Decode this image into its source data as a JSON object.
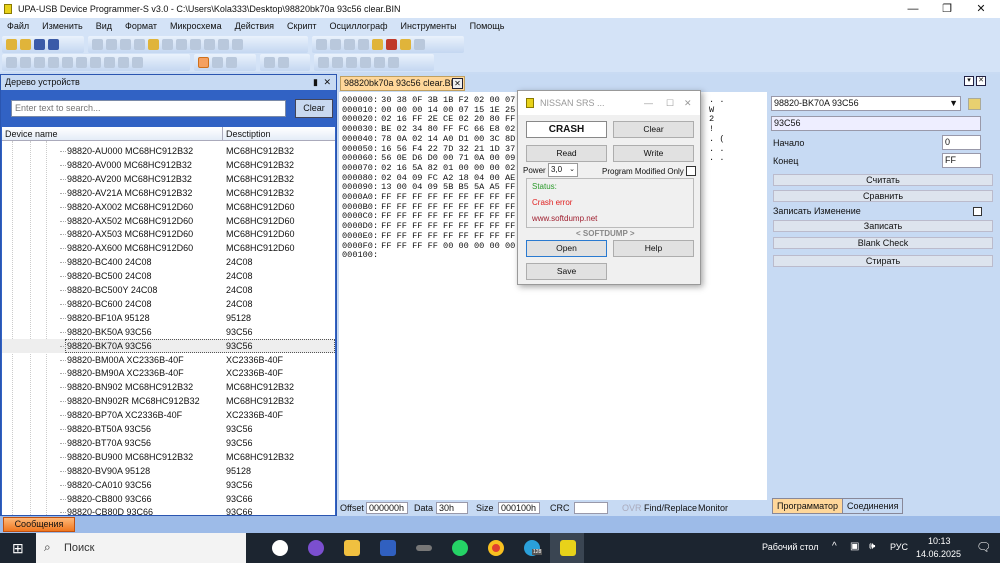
{
  "window": {
    "title": "UPA-USB Device Programmer-S v3.0 - C:\\Users\\Kola333\\Desktop\\98820bk70a 93c56 clear.BIN",
    "minimize": "—",
    "restore": "❐",
    "close": "✕"
  },
  "menu": [
    "Файл",
    "Изменить",
    "Вид",
    "Формат",
    "Микросхема",
    "Действия",
    "Скрипт",
    "Осциллограф",
    "Инструменты",
    "Помощь"
  ],
  "device_tree": {
    "title": "Дерево устройств",
    "search_placeholder": "Enter text to search...",
    "clear_label": "Clear",
    "col_name": "Device name",
    "col_desc": "Desctiption",
    "selected_index": 14,
    "rows": [
      [
        "98820-AU000 MC68HC912B32",
        "MC68HC912B32"
      ],
      [
        "98820-AV000 MC68HC912B32",
        "MC68HC912B32"
      ],
      [
        "98820-AV200 MC68HC912B32",
        "MC68HC912B32"
      ],
      [
        "98820-AV21A MC68HC912B32",
        "MC68HC912B32"
      ],
      [
        "98820-AX002 MC68HC912D60",
        "MC68HC912D60"
      ],
      [
        "98820-AX502 MC68HC912D60",
        "MC68HC912D60"
      ],
      [
        "98820-AX503 MC68HC912D60",
        "MC68HC912D60"
      ],
      [
        "98820-AX600 MC68HC912D60",
        "MC68HC912D60"
      ],
      [
        "98820-BC400 24C08",
        "24C08"
      ],
      [
        "98820-BC500 24C08",
        "24C08"
      ],
      [
        "98820-BC500Y 24C08",
        "24C08"
      ],
      [
        "98820-BC600 24C08",
        "24C08"
      ],
      [
        "98820-BF10A 95128",
        "95128"
      ],
      [
        "98820-BK50A 93C56",
        "93C56"
      ],
      [
        "98820-BK70A 93C56",
        "93C56"
      ],
      [
        "98820-BM00A XC2336B-40F",
        "XC2336B-40F"
      ],
      [
        "98820-BM90A XC2336B-40F",
        "XC2336B-40F"
      ],
      [
        "98820-BN902 MC68HC912B32",
        "MC68HC912B32"
      ],
      [
        "98820-BN902R MC68HC912B32",
        "MC68HC912B32"
      ],
      [
        "98820-BP70A XC2336B-40F",
        "XC2336B-40F"
      ],
      [
        "98820-BT50A 93C56",
        "93C56"
      ],
      [
        "98820-BT70A 93C56",
        "93C56"
      ],
      [
        "98820-BU900 MC68HC912B32",
        "MC68HC912B32"
      ],
      [
        "98820-BV90A 95128",
        "95128"
      ],
      [
        "98820-CA010 93C56",
        "93C56"
      ],
      [
        "98820-CB800 93C66",
        "93C66"
      ],
      [
        "98820-CB80D 93C66",
        "93C66"
      ]
    ]
  },
  "messages_tab": "Сообщения",
  "hex": {
    "tab": "98820bk70a 93c56 clear.BIN",
    "tab_close": "✕",
    "rows": [
      [
        "000000:",
        "30 38 0F 3B 1B F2 02 00 07 A9 11"
      ],
      [
        "000010:",
        "00 00 00 14 00 07 15 1E 25 06 19"
      ],
      [
        "000020:",
        "02 16 FF 2E CE 02 20 80 FF 57 BE"
      ],
      [
        "000030:",
        "BE 02 34 80 FF FC 66 E8 02 14 FF"
      ],
      [
        "000040:",
        "78 0A 02 14 A0 D1 00 3C 8D 05 7D"
      ],
      [
        "000050:",
        "16 56 F4 22 7D 32 21 1D 37 09 FF"
      ],
      [
        "000060:",
        "56 0E D6 D0 00 71 0A 00 09 19 5A"
      ],
      [
        "000070:",
        "02 16 5A 82 01 00 00 00 02 16 D7"
      ],
      [
        "000080:",
        "02 04 09 FC A2 18 04 00 AE 07 00"
      ],
      [
        "000090:",
        "13 00 04 09 5B B5 5A A5 FF FF FF"
      ],
      [
        "0000A0:",
        "FF FF FF FF FF FF FF FF FF FF FF"
      ],
      [
        "0000B0:",
        "FF FF FF FF FF FF FF FF FF FF FF"
      ],
      [
        "0000C0:",
        "FF FF FF FF FF FF FF FF FF FF FF"
      ],
      [
        "0000D0:",
        "FF FF FF FF FF FF FF FF FF FF FF"
      ],
      [
        "0000E0:",
        "FF FF FF FF FF FF FF FF FF FF FF"
      ],
      [
        "0000F0:",
        "FF FF FF FF 00 00 00 00 00 00 00"
      ],
      [
        "000100:",
        ""
      ]
    ],
    "ascii_visible": [
      ". .",
      "W",
      "2",
      "!",
      ". (",
      ". .",
      ". ."
    ]
  },
  "statusbar": {
    "offset_label": "Offset",
    "offset": "000000h",
    "data_label": "Data",
    "data": "30h",
    "size_label": "Size",
    "size": "000100h",
    "crc_label": "CRC",
    "crc": "",
    "ovr": "OVR",
    "find_replace": "Find/Replace",
    "monitor": "Monitor"
  },
  "programmer": {
    "device": "98820-BK70A 93C56",
    "chip": "93C56",
    "start_label": "Начало",
    "start": "0",
    "end_label": "Конец",
    "end": "FF",
    "read": "Считать",
    "compare": "Сравнить",
    "write_changes_label": "Записать Изменение",
    "write": "Записать",
    "blank_check": "Blank Check",
    "erase": "Стирать",
    "tabs": [
      "Программатор",
      "Соединения"
    ]
  },
  "dialog": {
    "title": "NISSAN SRS ...",
    "crash": "CRASH",
    "clear": "Clear",
    "read": "Read",
    "write": "Write",
    "power_label": "Power",
    "power": "3,0",
    "program_modified_only": "Program Modified Only",
    "status_label": "Status:",
    "status_msg": "Crash error",
    "site": "www.softdump.net",
    "brand": "< SOFTDUMP >",
    "open": "Open",
    "help": "Help",
    "save": "Save",
    "colors": {
      "status": "#2a9a2a",
      "error": "#e02020",
      "site": "#a02030"
    }
  },
  "taskbar": {
    "search": "Поиск",
    "desktop": "Рабочий стол",
    "lang": "РУС",
    "time": "10:13",
    "date": "14.06.2025",
    "telegram_badge": "128"
  }
}
